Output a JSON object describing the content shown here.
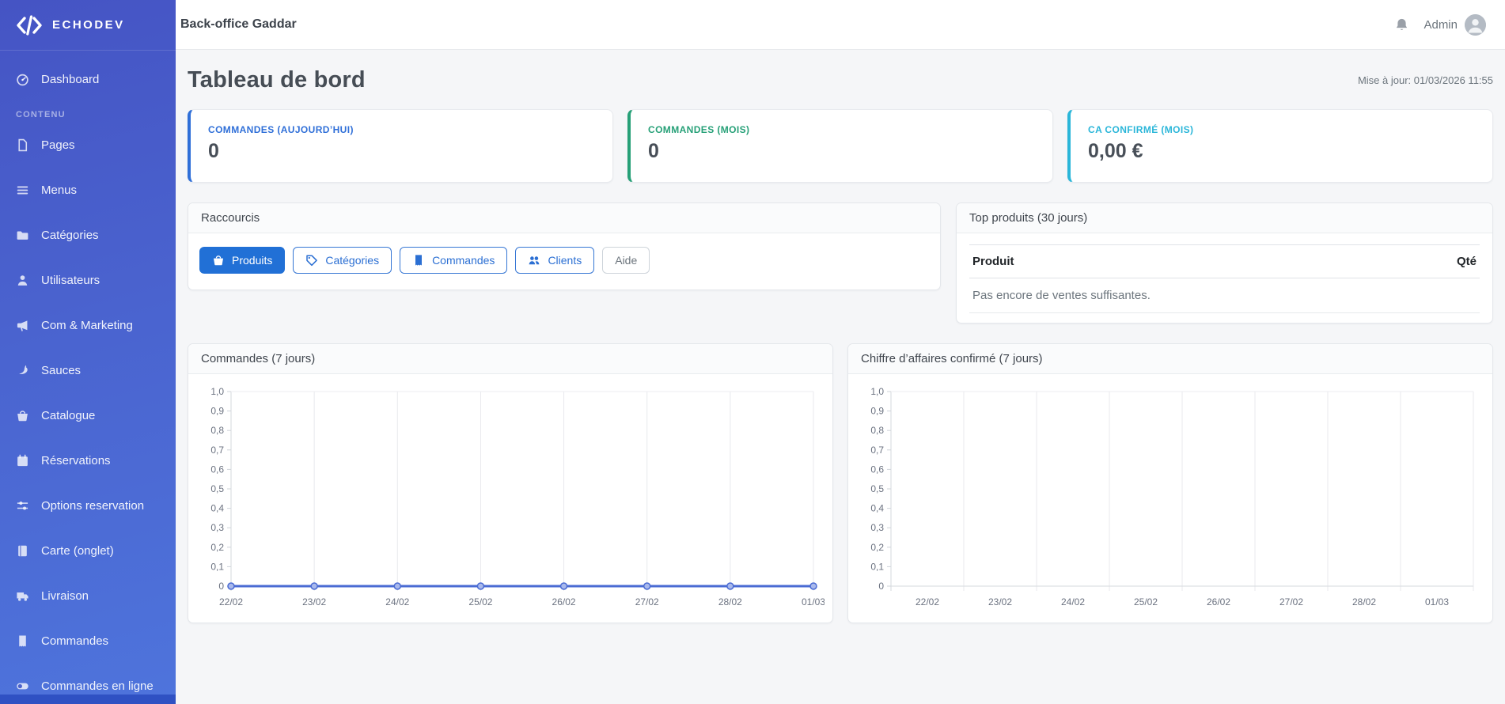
{
  "app": {
    "brand": "ECHODEV",
    "header_title": "Back-office Gaddar",
    "user_label": "Admin"
  },
  "sidebar": {
    "dashboard": {
      "label": "Dashboard",
      "icon": "speedometer-icon"
    },
    "section_label": "CONTENU",
    "items": [
      {
        "label": "Pages",
        "icon": "file-icon"
      },
      {
        "label": "Menus",
        "icon": "list-icon"
      },
      {
        "label": "Catégories",
        "icon": "folder-icon"
      },
      {
        "label": "Utilisateurs",
        "icon": "person-icon"
      },
      {
        "label": "Com & Marketing",
        "icon": "megaphone-icon"
      },
      {
        "label": "Sauces",
        "icon": "pepper-icon"
      },
      {
        "label": "Catalogue",
        "icon": "basket-icon"
      },
      {
        "label": "Réservations",
        "icon": "calendar-icon"
      },
      {
        "label": "Options reservation",
        "icon": "sliders-icon"
      },
      {
        "label": "Carte (onglet)",
        "icon": "journal-icon"
      },
      {
        "label": "Livraison",
        "icon": "truck-icon"
      },
      {
        "label": "Commandes",
        "icon": "receipt-icon"
      },
      {
        "label": "Commandes en ligne",
        "icon": "toggle-icon"
      }
    ]
  },
  "page": {
    "title": "Tableau de bord",
    "updated": "Mise à jour: 01/03/2026 11:55"
  },
  "stats": [
    {
      "label": "COMMANDES (AUJOURD’HUI)",
      "value": "0",
      "accent": "#2f6fd8"
    },
    {
      "label": "COMMANDES (MOIS)",
      "value": "0",
      "accent": "#26a077"
    },
    {
      "label": "CA CONFIRMÉ (MOIS)",
      "value": "0,00 €",
      "accent": "#2ab6d9"
    }
  ],
  "shortcuts": {
    "title": "Raccourcis",
    "buttons": [
      {
        "label": "Produits",
        "variant": "primary",
        "icon": "basket-icon"
      },
      {
        "label": "Catégories",
        "variant": "outline",
        "icon": "tag-icon"
      },
      {
        "label": "Commandes",
        "variant": "outline",
        "icon": "receipt-icon"
      },
      {
        "label": "Clients",
        "variant": "outline",
        "icon": "people-icon"
      },
      {
        "label": "Aide",
        "variant": "muted",
        "icon": ""
      }
    ]
  },
  "top_products": {
    "title": "Top produits (30 jours)",
    "columns": [
      "Produit",
      "Qté"
    ],
    "empty_message": "Pas encore de ventes suffisantes."
  },
  "chart_data": [
    {
      "type": "line",
      "title": "Commandes (7 jours)",
      "x": [
        "22/02",
        "23/02",
        "24/02",
        "25/02",
        "26/02",
        "27/02",
        "28/02",
        "01/03"
      ],
      "series": [
        {
          "name": "Commandes",
          "values": [
            0,
            0,
            0,
            0,
            0,
            0,
            0,
            0
          ]
        }
      ],
      "xlabel": "",
      "ylabel": "",
      "ylim": [
        0,
        1
      ],
      "yticks": [
        "1,0",
        "0,9",
        "0,8",
        "0,7",
        "0,6",
        "0,5",
        "0,4",
        "0,3",
        "0,2",
        "0,1",
        "0"
      ],
      "grid": "vertical",
      "legend": "none",
      "x_label_mode": "on-tick",
      "line_color": "#4a6bd3"
    },
    {
      "type": "line",
      "title": "Chiffre d’affaires confirmé (7 jours)",
      "x": [
        "22/02",
        "23/02",
        "24/02",
        "25/02",
        "26/02",
        "27/02",
        "28/02",
        "01/03"
      ],
      "series": [],
      "xlabel": "",
      "ylabel": "",
      "ylim": [
        0,
        1
      ],
      "yticks": [
        "1,0",
        "0,9",
        "0,8",
        "0,7",
        "0,6",
        "0,5",
        "0,4",
        "0,3",
        "0,2",
        "0,1",
        "0"
      ],
      "grid": "vertical",
      "legend": "none",
      "x_label_mode": "between-ticks",
      "line_color": "#4a6bd3"
    }
  ]
}
